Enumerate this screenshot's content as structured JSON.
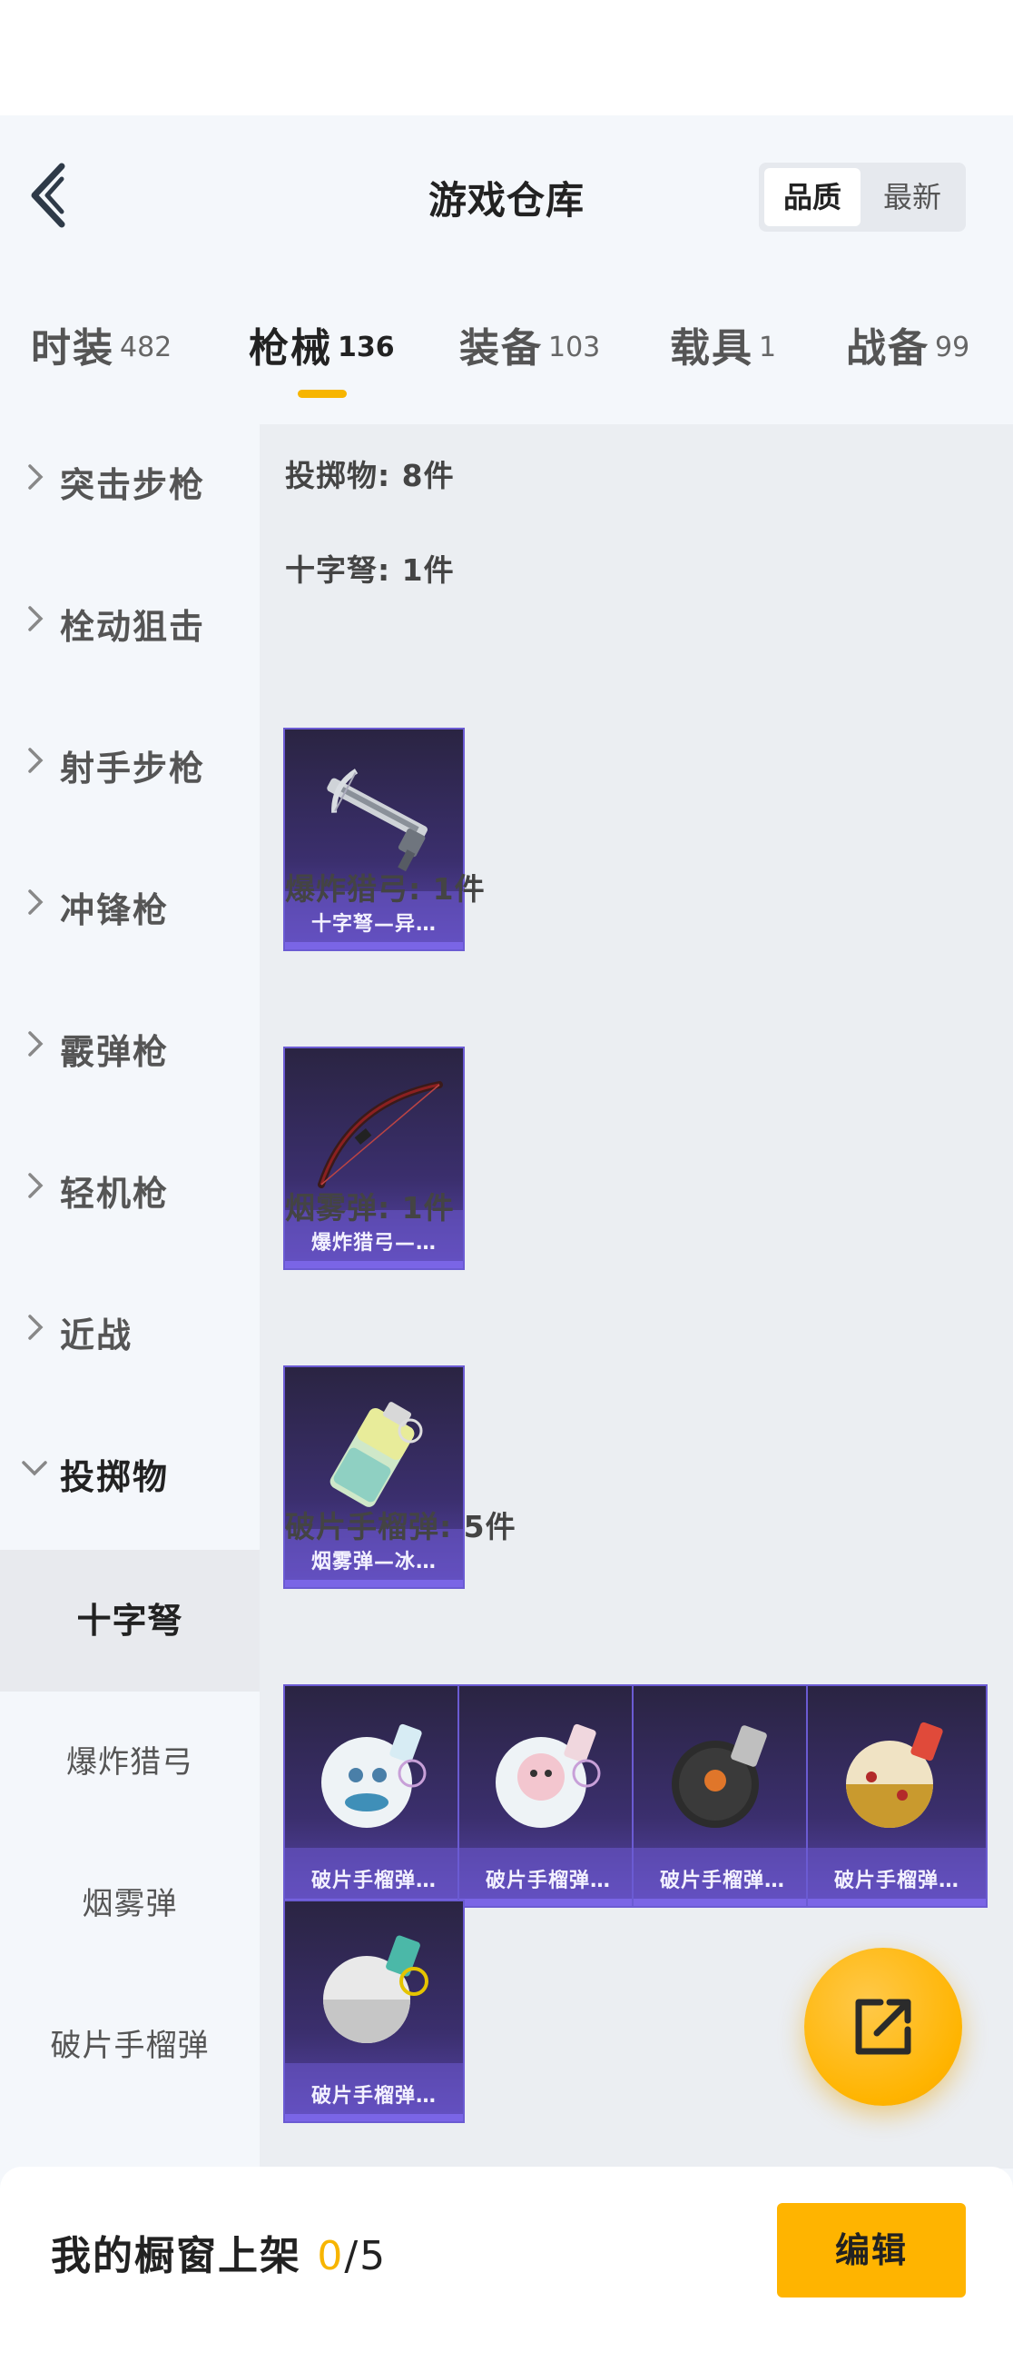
{
  "header": {
    "title": "游戏仓库",
    "sort_options": [
      "品质",
      "最新"
    ]
  },
  "tabs": [
    {
      "name": "时装",
      "count": "482"
    },
    {
      "name": "枪械",
      "count": "136"
    },
    {
      "name": "装备",
      "count": "103"
    },
    {
      "name": "载具",
      "count": "1"
    },
    {
      "name": "战备",
      "count": "99"
    }
  ],
  "sidebar": {
    "categories": [
      "突击步枪",
      "栓动狙击",
      "射手步枪",
      "冲锋枪",
      "霰弹枪",
      "轻机枪",
      "近战",
      "投掷物"
    ],
    "subitems": [
      "十字弩",
      "爆炸猎弓",
      "烟雾弹",
      "破片手榴弹"
    ]
  },
  "content": {
    "summary": "投掷物: 8件",
    "sections": [
      {
        "title": "十字弩: 1件",
        "items": [
          "十字弩—异…"
        ]
      },
      {
        "title": "爆炸猎弓: 1件",
        "items": [
          "爆炸猎弓—…"
        ]
      },
      {
        "title": "烟雾弹: 1件",
        "items": [
          "烟雾弹—冰…"
        ]
      },
      {
        "title": "破片手榴弹: 5件",
        "items": [
          "破片手榴弹…",
          "破片手榴弹…",
          "破片手榴弹…",
          "破片手榴弹…",
          "破片手榴弹…"
        ]
      }
    ]
  },
  "bottom": {
    "label": "我的橱窗上架",
    "used": "0",
    "total": "/5",
    "edit_label": "编辑"
  },
  "colors": {
    "accent": "#FFB400",
    "card_border": "#6B5BD3",
    "card_bg": "#2A2442"
  },
  "icons": {
    "back": "chevron-left-icon",
    "expand": "chevron-right-icon",
    "collapse": "chevron-down-icon",
    "share": "external-link-icon"
  }
}
